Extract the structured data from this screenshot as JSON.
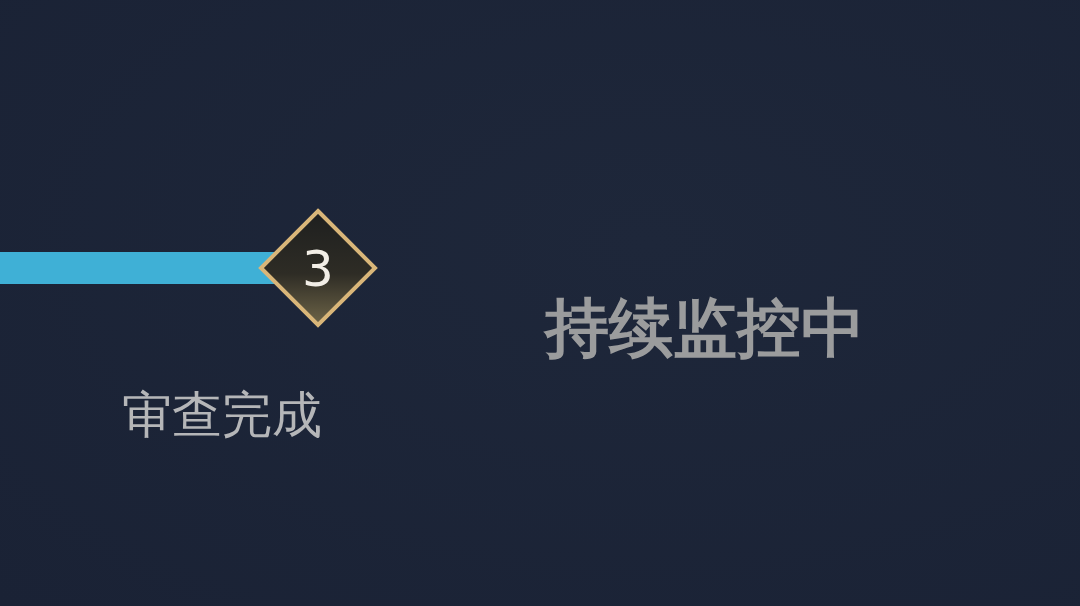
{
  "step": {
    "number": "3",
    "label": "审查完成"
  },
  "status": "持续监控中"
}
